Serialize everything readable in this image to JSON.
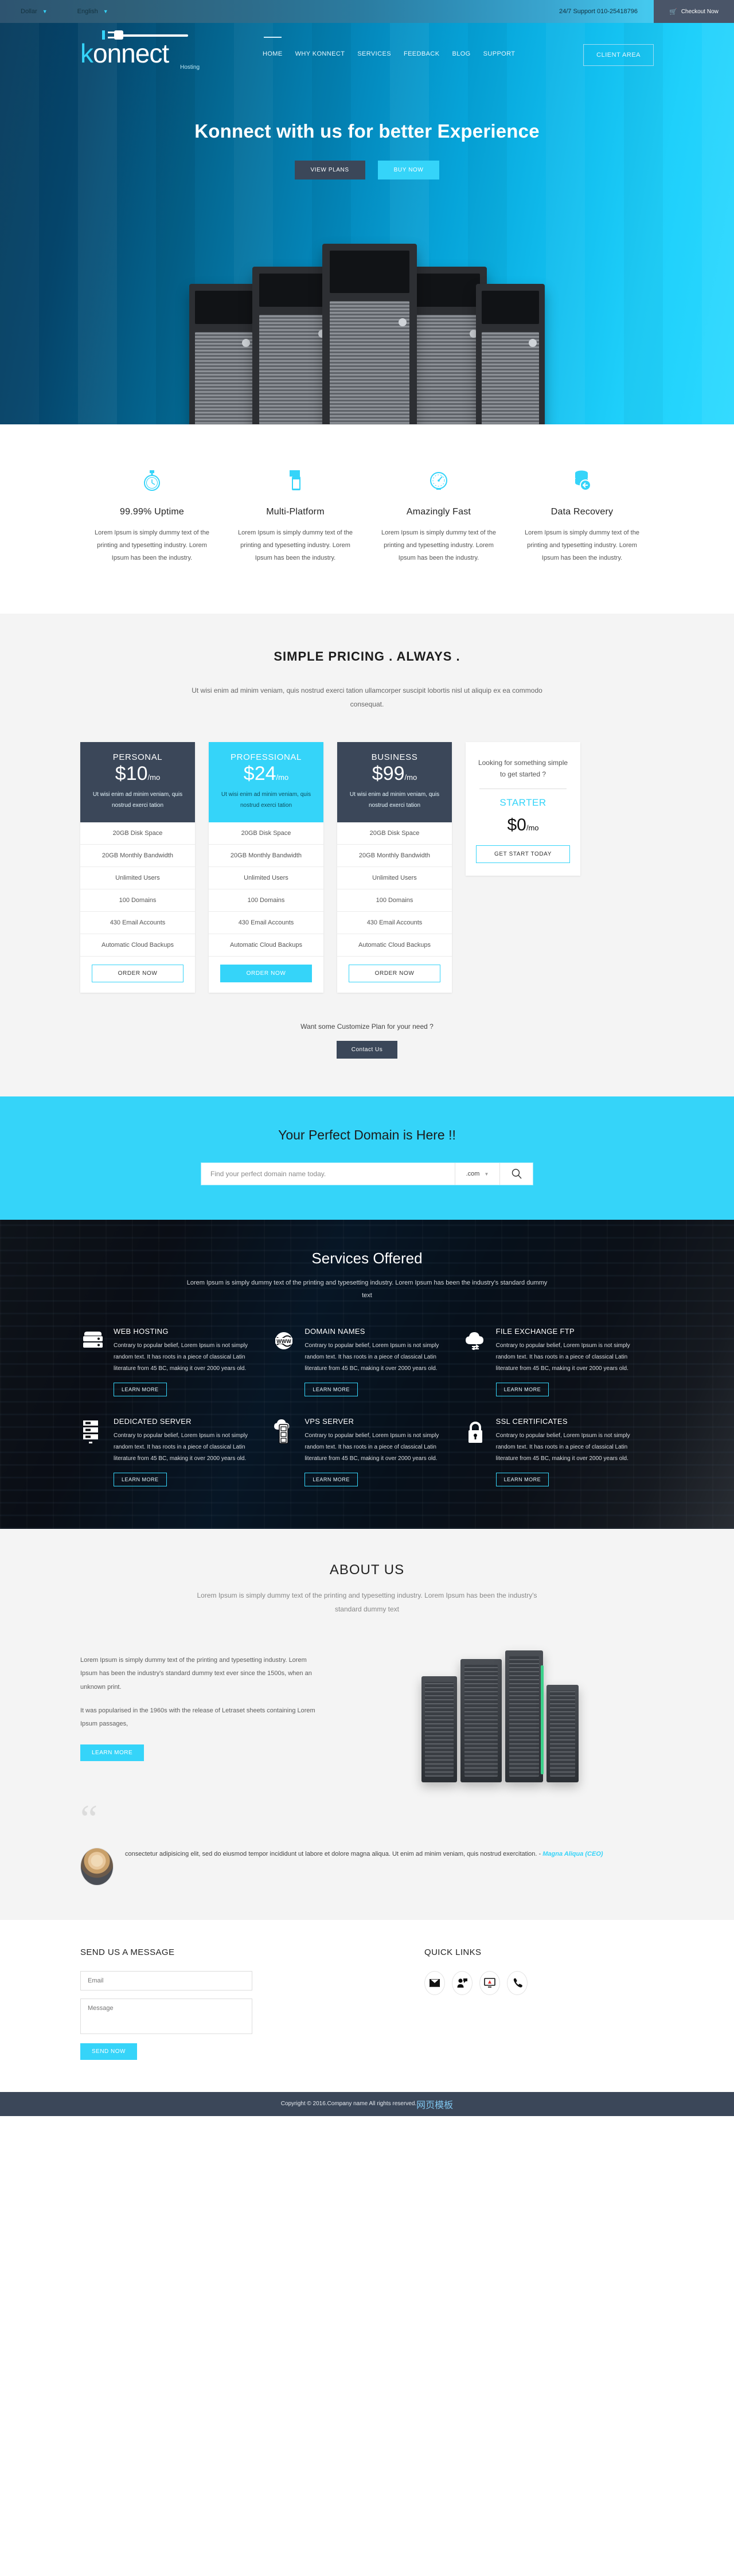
{
  "topbar": {
    "currency": "Dollar",
    "language": "English",
    "support": "24/7 Support 010-25418796",
    "checkout": "Checkout Now",
    "cart_icon": "cart-icon"
  },
  "brand": {
    "name_k": "k",
    "name_rest": "onnect",
    "tagline": "Hosting"
  },
  "nav": {
    "items": [
      "HOME",
      "WHY KONNECT",
      "SERVICES",
      "FEEDBACK",
      "BLOG",
      "SUPPORT"
    ],
    "client_area": "CLIENT AREA"
  },
  "hero": {
    "title": "Konnect with us for better Experience",
    "btn_primary": "VIEW PLANS",
    "btn_secondary": "BUY NOW"
  },
  "features": [
    {
      "icon": "stopwatch-icon",
      "title": "99.99% Uptime",
      "text": "Lorem Ipsum is simply dummy text of the printing and typesetting industry. Lorem Ipsum has been the industry."
    },
    {
      "icon": "devices-icon",
      "title": "Multi-Platform",
      "text": "Lorem Ipsum is simply dummy text of the printing and typesetting industry. Lorem Ipsum has been the industry."
    },
    {
      "icon": "speedometer-icon",
      "title": "Amazingly Fast",
      "text": "Lorem Ipsum is simply dummy text of the printing and typesetting industry. Lorem Ipsum has been the industry."
    },
    {
      "icon": "database-restore-icon",
      "title": "Data Recovery",
      "text": "Lorem Ipsum is simply dummy text of the printing and typesetting industry. Lorem Ipsum has been the industry."
    }
  ],
  "pricing": {
    "title": "SIMPLE PRICING . ALWAYS .",
    "subtitle": "Ut wisi enim ad minim veniam, quis nostrud exerci tation ullamcorper suscipit lobortis nisl ut aliquip ex ea commodo consequat.",
    "plans": [
      {
        "name": "PERSONAL",
        "price": "$10",
        "period": "/mo",
        "desc": "Ut wisi enim ad minim veniam, quis nostrud exerci tation",
        "features": [
          "20GB Disk Space",
          "20GB Monthly Bandwidth",
          "Unlimited Users",
          "100 Domains",
          "430 Email Accounts",
          "Automatic Cloud Backups"
        ],
        "cta": "ORDER NOW",
        "style": "dark"
      },
      {
        "name": "PROFESSIONAL",
        "price": "$24",
        "period": "/mo",
        "desc": "Ut wisi enim ad minim veniam, quis nostrud exerci tation",
        "features": [
          "20GB Disk Space",
          "20GB Monthly Bandwidth",
          "Unlimited Users",
          "100 Domains",
          "430 Email Accounts",
          "Automatic Cloud Backups"
        ],
        "cta": "ORDER NOW",
        "style": "cyan"
      },
      {
        "name": "BUSINESS",
        "price": "$99",
        "period": "/mo",
        "desc": "Ut wisi enim ad minim veniam, quis nostrud exerci tation",
        "features": [
          "20GB Disk Space",
          "20GB Monthly Bandwidth",
          "Unlimited Users",
          "100 Domains",
          "430 Email Accounts",
          "Automatic Cloud Backups"
        ],
        "cta": "ORDER NOW",
        "style": "dark"
      }
    ],
    "starter": {
      "question": "Looking for something simple to get started ?",
      "name": "STARTER",
      "price": "$0",
      "period": "/mo",
      "cta": "GET START TODAY"
    },
    "custom_text": "Want some Customize Plan for your need ?",
    "custom_cta": "Contact Us"
  },
  "domain": {
    "title": "Your Perfect Domain is Here !!",
    "placeholder": "Find your perfect domain name today.",
    "tld": ".com",
    "search_icon": "search-icon"
  },
  "services": {
    "title": "Services Offered",
    "subtitle": "Lorem Ipsum is simply dummy text of the printing and typesetting industry. Lorem Ipsum has been the industry's standard dummy text",
    "body": "Contrary to popular belief, Lorem Ipsum is not simply random text. It has roots in a piece of classical Latin literature from 45 BC, making it over 2000 years old.",
    "learn": "LEARN MORE",
    "items": [
      {
        "icon": "server-icon",
        "title": "WEB HOSTING"
      },
      {
        "icon": "globe-www-icon",
        "title": "DOMAIN NAMES"
      },
      {
        "icon": "cloud-exchange-icon",
        "title": "FILE EXCHANGE FTP"
      },
      {
        "icon": "rack-server-icon",
        "title": "DEDICATED SERVER"
      },
      {
        "icon": "cloud-server-icon",
        "title": "VPS SERVER"
      },
      {
        "icon": "lock-icon",
        "title": "SSL CERTIFICATES"
      }
    ]
  },
  "about": {
    "title": "ABOUT US",
    "lead": "Lorem Ipsum is simply dummy text of the printing and typesetting industry. Lorem Ipsum has been the industry's standard dummy text",
    "p1": "Lorem Ipsum is simply dummy text of the printing and typesetting industry. Lorem Ipsum has been the industry's standard dummy text ever since the 1500s, when an unknown print.",
    "p2": "It was popularised in the 1960s with the release of Letraset sheets containing Lorem Ipsum passages,",
    "cta": "LEARN MORE",
    "quote_mark": "“",
    "testimonial": "consectetur adipisicing elit, sed do eiusmod tempor incididunt ut labore et dolore magna aliqua. Ut enim ad minim veniam, quis nostrud exercitation. - ",
    "testimonial_author": "Magna Aliqua (CEO)",
    "avatar": "avatar"
  },
  "contact": {
    "title": "SEND US A MESSAGE",
    "email_placeholder": "Email",
    "email_value": "",
    "message_placeholder": "Message",
    "message_value": "",
    "send": "SEND NOW",
    "quick_links_title": "QUICK LINKS",
    "quick_links": [
      {
        "icon": "envelope-icon",
        "glyph": "✉"
      },
      {
        "icon": "live-chat-icon",
        "glyph": "⚈"
      },
      {
        "icon": "monitor-alert-icon",
        "glyph": "⌨"
      },
      {
        "icon": "phone-icon",
        "glyph": "☎"
      }
    ]
  },
  "footer": {
    "copyright": "Copyright © 2016.Company name All rights reserved.",
    "link": "网页模板"
  }
}
